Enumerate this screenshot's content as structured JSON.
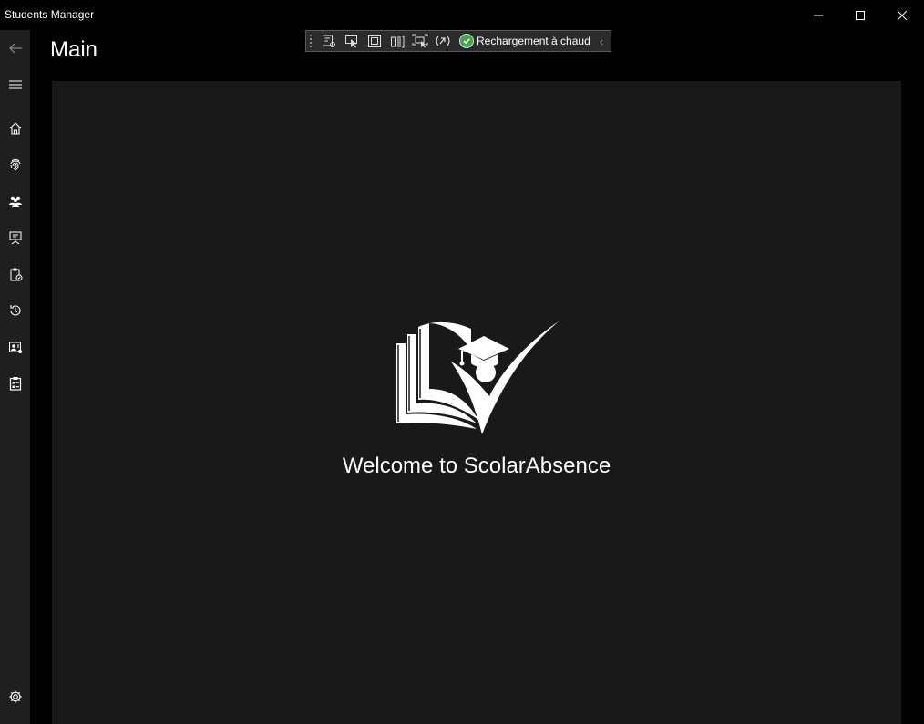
{
  "window": {
    "title": "Students Manager",
    "minimize_icon": "minimize-icon",
    "maximize_icon": "maximize-icon",
    "close_icon": "close-icon"
  },
  "nav": {
    "back_icon": "back-arrow-icon",
    "menu_icon": "hamburger-icon",
    "items": [
      {
        "icon": "home-icon"
      },
      {
        "icon": "fingerprint-icon"
      },
      {
        "icon": "people-icon"
      },
      {
        "icon": "presentation-icon"
      },
      {
        "icon": "clipboard-icon"
      },
      {
        "icon": "history-icon"
      },
      {
        "icon": "contact-card-icon"
      },
      {
        "icon": "checklist-icon"
      }
    ],
    "settings_icon": "gear-icon"
  },
  "page": {
    "title": "Main"
  },
  "devtools": {
    "status_text": "Rechargement à chaud",
    "status_icon": "check-circle-icon"
  },
  "main": {
    "welcome": "Welcome to ScolarAbsence"
  },
  "colors": {
    "background": "#000000",
    "nav": "#1f1f1f",
    "content": "#191919",
    "status_ok": "#4aa34a"
  }
}
